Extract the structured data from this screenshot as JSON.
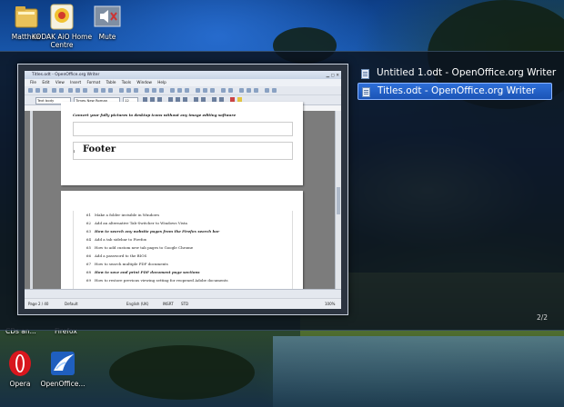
{
  "desktop": {
    "top_icons": [
      {
        "label": "Matthew",
        "icon": "user-folder-icon"
      },
      {
        "label": "KODAK AiO Home Centre",
        "icon": "kodak-icon"
      },
      {
        "label": "Mute",
        "icon": "mute-icon"
      }
    ],
    "bottom_partial_labels": [
      "CDs an...",
      "Firefox"
    ],
    "bottom_icons": [
      {
        "label": "Opera",
        "icon": "opera-icon"
      },
      {
        "label": "OpenOffice...",
        "icon": "openoffice-icon"
      }
    ]
  },
  "switcher": {
    "windows": [
      {
        "title": "Untitled 1.odt - OpenOffice.org Writer",
        "selected": false
      },
      {
        "title": "Titles.odt - OpenOffice.org Writer",
        "selected": true
      }
    ],
    "counter": "2/2",
    "colors": {
      "selected": "#1f5fc4",
      "panel": "#0c1420"
    }
  },
  "preview": {
    "window_title": "Titles.odt - OpenOffice.org Writer",
    "menus": [
      "File",
      "Edit",
      "View",
      "Insert",
      "Format",
      "Table",
      "Tools",
      "Window",
      "Help"
    ],
    "style_box": "Text body",
    "font_box": "Times New Roman",
    "size_box": "12",
    "page1": {
      "top_line": "Convert your fully pictures to desktop icons without any image editing software",
      "footer_num": "1",
      "footer_text": "Footer"
    },
    "page2_lines": [
      {
        "n": "61",
        "t": "Make a folder invisible in Windows",
        "bold": false
      },
      {
        "n": "62",
        "t": "Add an alternative Tab-Switcher to Windows Vista",
        "bold": false
      },
      {
        "n": "63",
        "t": "How to search any website pages from the Firefox search bar",
        "bold": true
      },
      {
        "n": "64",
        "t": "Add a tab sidebar to Firefox",
        "bold": false
      },
      {
        "n": "65",
        "t": "How to add custom new tab pages to Google Chrome",
        "bold": false
      },
      {
        "n": "66",
        "t": "Add a password to the BIOS",
        "bold": false
      },
      {
        "n": "67",
        "t": "How to search multiple PDF documents",
        "bold": false
      },
      {
        "n": "68",
        "t": "How to save and print PDF document page sections",
        "bold": true
      },
      {
        "n": "69",
        "t": "How to restore previous viewing setting for reopened Adobe documents",
        "bold": false
      }
    ],
    "status": {
      "page": "Page 2 / 40",
      "style": "Default",
      "lang": "English (UK)",
      "mode": "INSRT",
      "sel": "STD",
      "zoom": "100%"
    }
  }
}
